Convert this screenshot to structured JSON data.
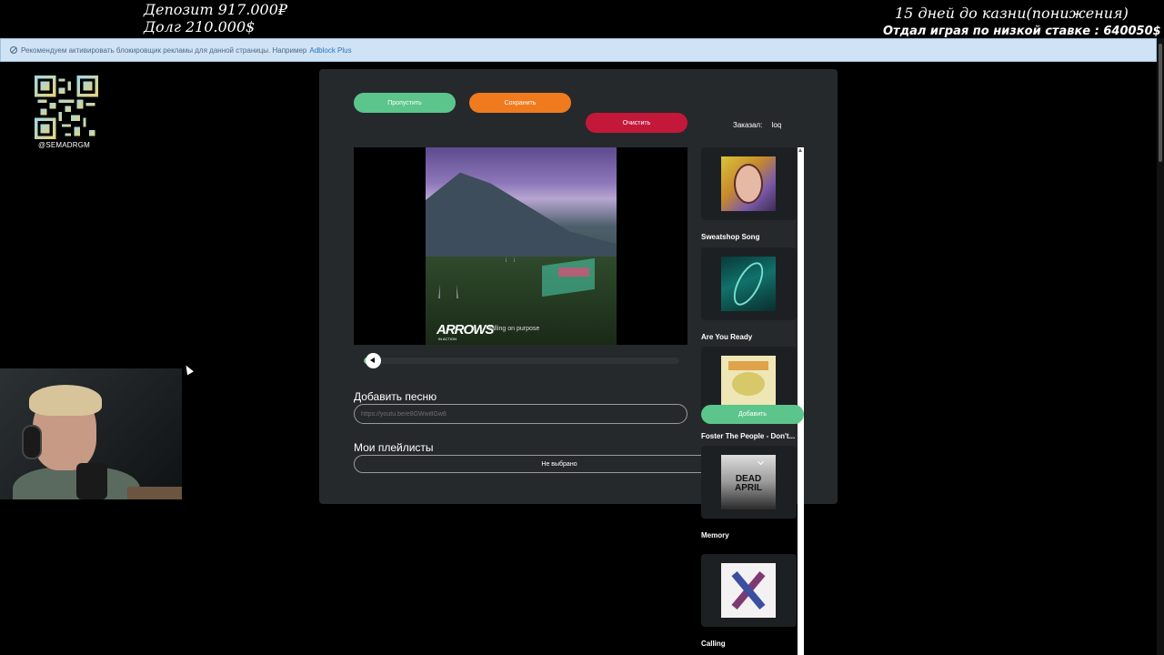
{
  "overlay": {
    "deposit": "Депозит 917.000₽",
    "debt": "Долг  210.000$",
    "days": "15 дней до казни(понижения)",
    "lost": "Отдал играя по низкой ставке : 640050$",
    "qr_label": "@SEMADRGM"
  },
  "banner": {
    "text": "Рекомендуем активировать блокировщик рекламы для данной страницы. Например",
    "link": "Adblock Plus"
  },
  "controls": {
    "skip": "Пропустить",
    "save": "Сохранить",
    "clear": "Очистить",
    "ordered_label": "Заказал:",
    "ordered_user": "loq"
  },
  "player": {
    "cover_brand": "ARROWS",
    "cover_brand_sub": "IN ACTION",
    "cover_album": "falling on purpose",
    "progress": 0.03
  },
  "add_song": {
    "label": "Добавить песню",
    "placeholder": "https://youtu.be/e8GWwillGw8"
  },
  "playlists": {
    "label": "Мои плейлисты",
    "selected": "Не выбрано"
  },
  "queue": {
    "add_button": "Добавить",
    "items": [
      {
        "title": "Sweatshop Song"
      },
      {
        "title": "Are You Ready"
      },
      {
        "title": "Foster The People - Don't..."
      },
      {
        "title": "Memory",
        "art_text": "DEAD APRIL"
      },
      {
        "title": "Calling"
      }
    ]
  },
  "colors": {
    "skip": "#5cc58b",
    "save": "#f07a1e",
    "clear": "#c4183a",
    "panel": "#26292b"
  }
}
